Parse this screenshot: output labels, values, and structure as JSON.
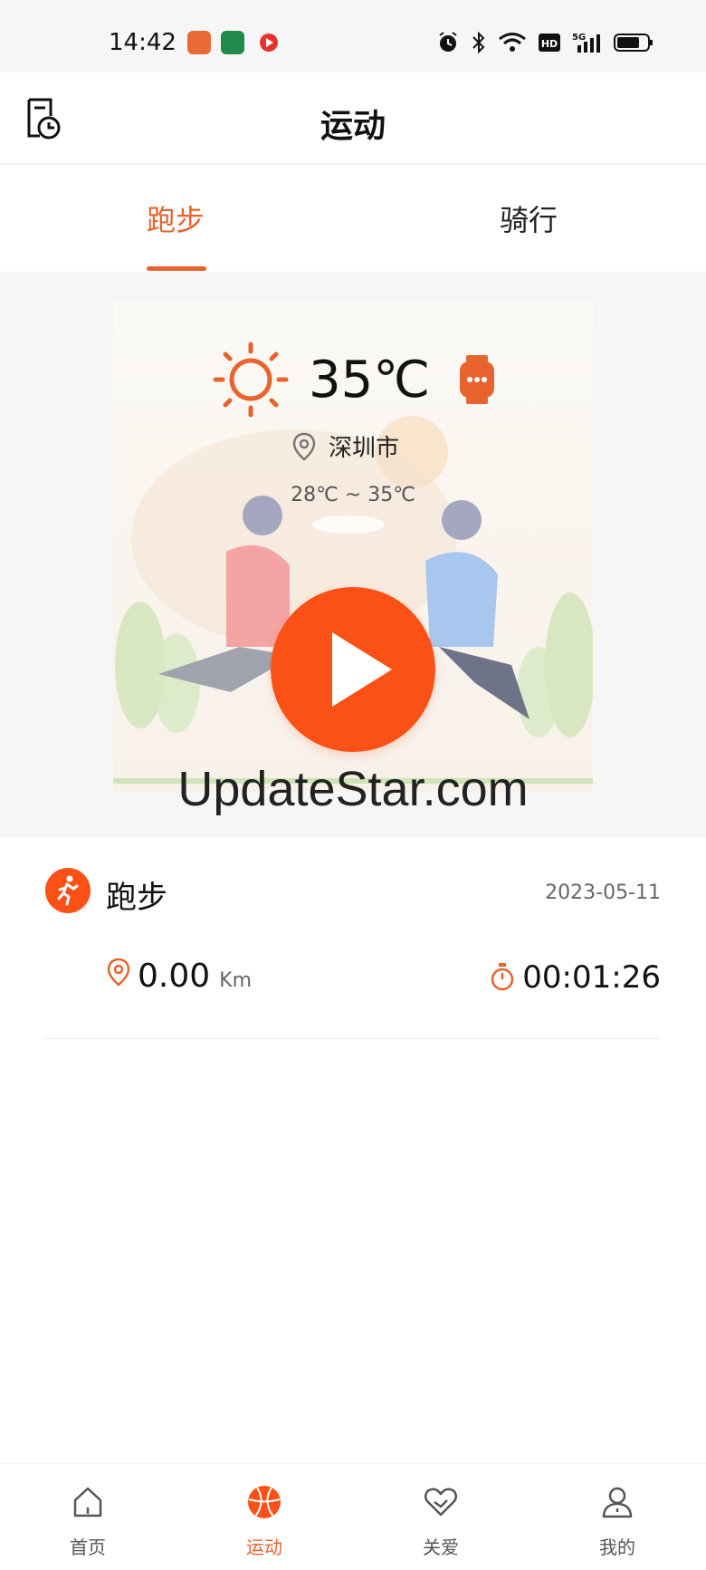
{
  "status_bar": {
    "time": "14:42",
    "app_icons": [
      "orange-app-icon",
      "oppo-app-icon",
      "red-play-app-icon"
    ],
    "indicators": [
      "alarm-icon",
      "bluetooth-icon",
      "wifi-icon",
      "hd-icon",
      "5g-signal-icon",
      "battery-icon"
    ]
  },
  "header": {
    "title": "运动",
    "history_icon": "history-icon"
  },
  "tabs": [
    {
      "label": "跑步",
      "active": true
    },
    {
      "label": "骑行",
      "active": false
    }
  ],
  "weather": {
    "temperature": "35℃",
    "city": "深圳市",
    "range": "28℃ ~ 35℃",
    "icon": "sun-icon",
    "device_icon": "watch-icon"
  },
  "hero": {
    "play_icon": "play-icon",
    "watermark": "UpdateStar.com"
  },
  "record": {
    "type_label": "跑步",
    "date": "2023-05-11",
    "distance": "0.00",
    "distance_unit": "Km",
    "duration": "00:01:26",
    "accent_color": "#fb5117"
  },
  "bottom_nav": [
    {
      "label": "首页",
      "icon": "home-icon",
      "active": false
    },
    {
      "label": "运动",
      "icon": "basketball-icon",
      "active": true
    },
    {
      "label": "关爱",
      "icon": "heart-icon",
      "active": false
    },
    {
      "label": "我的",
      "icon": "user-icon",
      "active": false
    }
  ],
  "colors": {
    "accent": "#e8632d",
    "play_button": "#fb5117"
  }
}
